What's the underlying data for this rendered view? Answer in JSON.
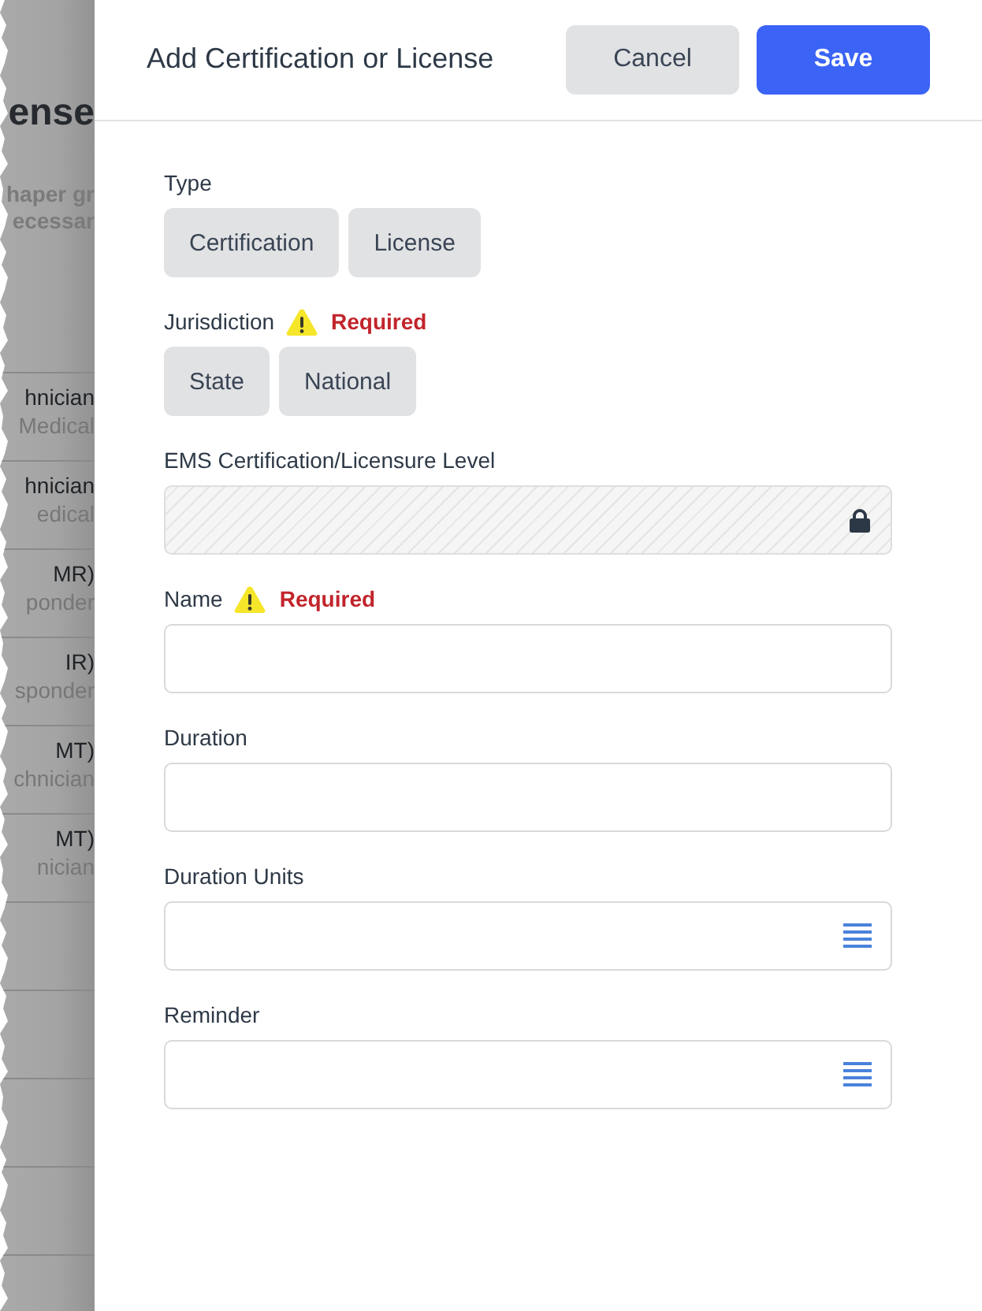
{
  "background_page": {
    "heading": "ense",
    "description": [
      "haper gr",
      "ecessar"
    ],
    "rows": [
      {
        "title": "hnician",
        "subtitle": "Medical"
      },
      {
        "title": "hnician",
        "subtitle": "edical"
      },
      {
        "title": "MR)",
        "subtitle": "ponder"
      },
      {
        "title": "IR)",
        "subtitle": "sponder"
      },
      {
        "title": "MT)",
        "subtitle": "chnician"
      },
      {
        "title": "MT)",
        "subtitle": "nician"
      }
    ]
  },
  "panel": {
    "title": "Add Certification or License",
    "buttons": [
      {
        "label": "Cancel",
        "kind": "secondary"
      },
      {
        "label": "Save",
        "kind": "primary"
      }
    ]
  },
  "form": {
    "fields": [
      {
        "kind": "toggle",
        "label": "Type",
        "options": [
          {
            "label": "Certification",
            "selected": false
          },
          {
            "label": "License",
            "selected": false
          }
        ]
      },
      {
        "kind": "toggle",
        "label": "Jurisdiction",
        "warning": "Required",
        "options": [
          {
            "label": "State",
            "selected": false
          },
          {
            "label": "National",
            "selected": false
          }
        ]
      },
      {
        "kind": "locked",
        "label": "EMS Certification/Licensure Level"
      },
      {
        "kind": "text",
        "label": "Name",
        "warning": "Required"
      },
      {
        "kind": "text",
        "label": "Duration"
      },
      {
        "kind": "select",
        "label": "Duration Units"
      },
      {
        "kind": "select",
        "label": "Reminder"
      }
    ]
  }
}
